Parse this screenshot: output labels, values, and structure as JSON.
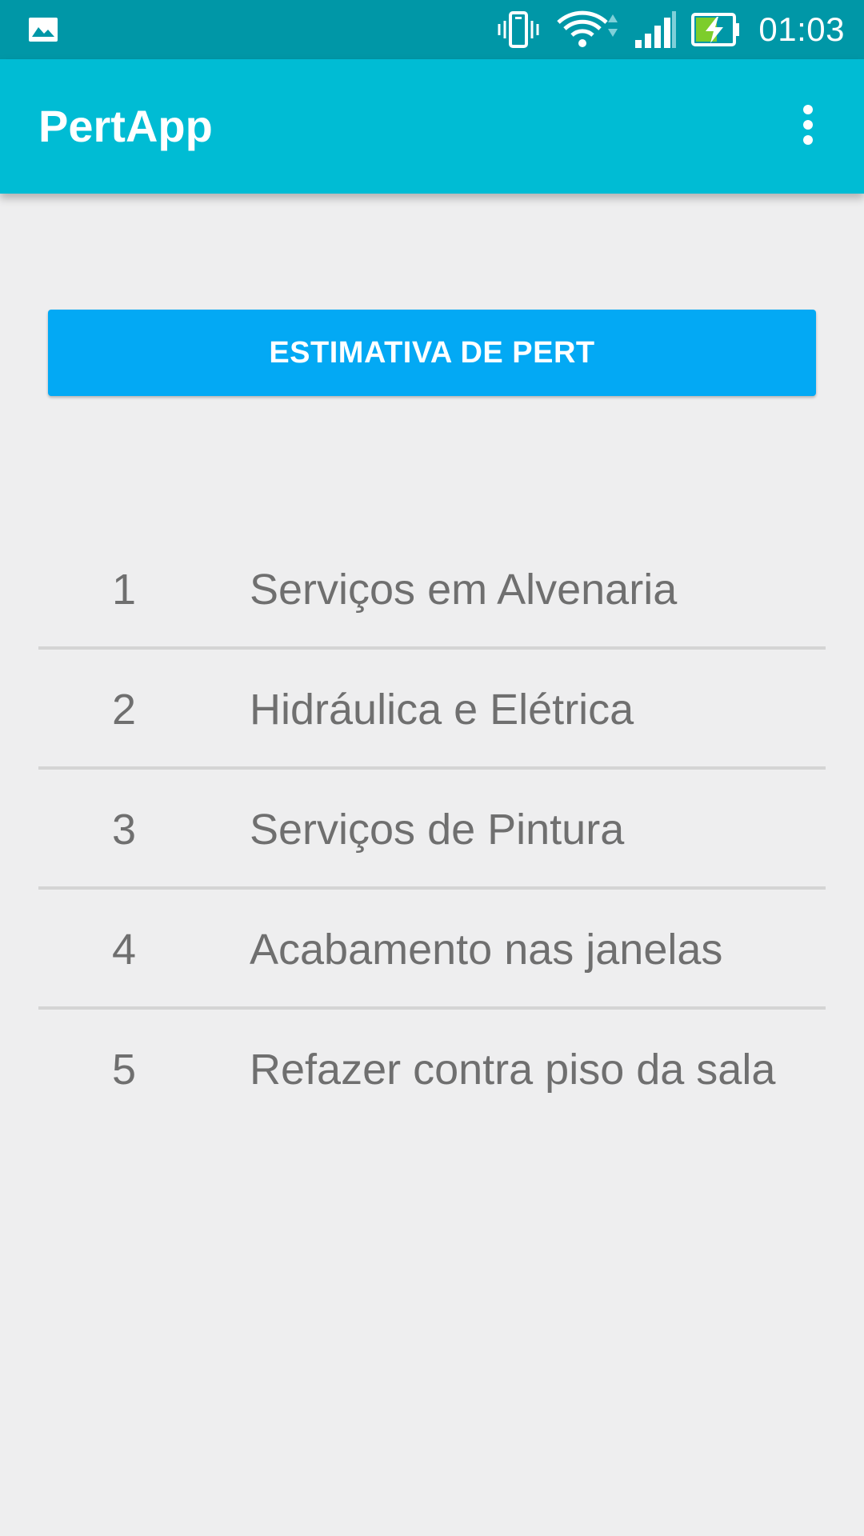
{
  "status_bar": {
    "time": "01:03",
    "icons": [
      "image-notification-icon",
      "vibrate-icon",
      "wifi-icon",
      "cell-signal-icon",
      "battery-charging-icon"
    ]
  },
  "app_bar": {
    "title": "PertApp",
    "menu_icon": "overflow-menu-icon"
  },
  "main": {
    "primary_button_label": "ESTIMATIVA DE PERT",
    "tasks": [
      {
        "number": "1",
        "name": "Serviços em Alvenaria"
      },
      {
        "number": "2",
        "name": "Hidráulica e Elétrica"
      },
      {
        "number": "3",
        "name": "Serviços de Pintura"
      },
      {
        "number": "4",
        "name": "Acabamento nas janelas"
      },
      {
        "number": "5",
        "name": "Refazer contra piso da sala"
      }
    ]
  },
  "colors": {
    "status_bar": "#0097a7",
    "app_bar": "#00bcd4",
    "button": "#03a9f4",
    "background": "#eeeeef",
    "list_text": "#6f6f6f",
    "divider": "#d4d4d4"
  }
}
